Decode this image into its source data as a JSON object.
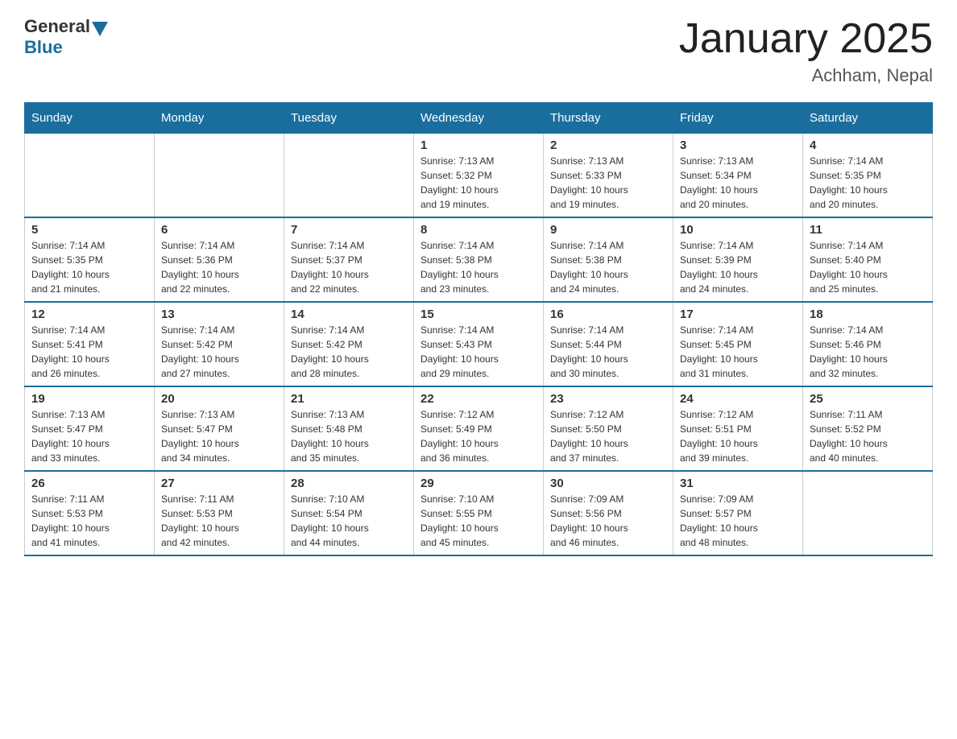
{
  "header": {
    "logo_general": "General",
    "logo_blue": "Blue",
    "title": "January 2025",
    "subtitle": "Achham, Nepal"
  },
  "calendar": {
    "days_of_week": [
      "Sunday",
      "Monday",
      "Tuesday",
      "Wednesday",
      "Thursday",
      "Friday",
      "Saturday"
    ],
    "weeks": [
      [
        {
          "day": "",
          "info": ""
        },
        {
          "day": "",
          "info": ""
        },
        {
          "day": "",
          "info": ""
        },
        {
          "day": "1",
          "info": "Sunrise: 7:13 AM\nSunset: 5:32 PM\nDaylight: 10 hours\nand 19 minutes."
        },
        {
          "day": "2",
          "info": "Sunrise: 7:13 AM\nSunset: 5:33 PM\nDaylight: 10 hours\nand 19 minutes."
        },
        {
          "day": "3",
          "info": "Sunrise: 7:13 AM\nSunset: 5:34 PM\nDaylight: 10 hours\nand 20 minutes."
        },
        {
          "day": "4",
          "info": "Sunrise: 7:14 AM\nSunset: 5:35 PM\nDaylight: 10 hours\nand 20 minutes."
        }
      ],
      [
        {
          "day": "5",
          "info": "Sunrise: 7:14 AM\nSunset: 5:35 PM\nDaylight: 10 hours\nand 21 minutes."
        },
        {
          "day": "6",
          "info": "Sunrise: 7:14 AM\nSunset: 5:36 PM\nDaylight: 10 hours\nand 22 minutes."
        },
        {
          "day": "7",
          "info": "Sunrise: 7:14 AM\nSunset: 5:37 PM\nDaylight: 10 hours\nand 22 minutes."
        },
        {
          "day": "8",
          "info": "Sunrise: 7:14 AM\nSunset: 5:38 PM\nDaylight: 10 hours\nand 23 minutes."
        },
        {
          "day": "9",
          "info": "Sunrise: 7:14 AM\nSunset: 5:38 PM\nDaylight: 10 hours\nand 24 minutes."
        },
        {
          "day": "10",
          "info": "Sunrise: 7:14 AM\nSunset: 5:39 PM\nDaylight: 10 hours\nand 24 minutes."
        },
        {
          "day": "11",
          "info": "Sunrise: 7:14 AM\nSunset: 5:40 PM\nDaylight: 10 hours\nand 25 minutes."
        }
      ],
      [
        {
          "day": "12",
          "info": "Sunrise: 7:14 AM\nSunset: 5:41 PM\nDaylight: 10 hours\nand 26 minutes."
        },
        {
          "day": "13",
          "info": "Sunrise: 7:14 AM\nSunset: 5:42 PM\nDaylight: 10 hours\nand 27 minutes."
        },
        {
          "day": "14",
          "info": "Sunrise: 7:14 AM\nSunset: 5:42 PM\nDaylight: 10 hours\nand 28 minutes."
        },
        {
          "day": "15",
          "info": "Sunrise: 7:14 AM\nSunset: 5:43 PM\nDaylight: 10 hours\nand 29 minutes."
        },
        {
          "day": "16",
          "info": "Sunrise: 7:14 AM\nSunset: 5:44 PM\nDaylight: 10 hours\nand 30 minutes."
        },
        {
          "day": "17",
          "info": "Sunrise: 7:14 AM\nSunset: 5:45 PM\nDaylight: 10 hours\nand 31 minutes."
        },
        {
          "day": "18",
          "info": "Sunrise: 7:14 AM\nSunset: 5:46 PM\nDaylight: 10 hours\nand 32 minutes."
        }
      ],
      [
        {
          "day": "19",
          "info": "Sunrise: 7:13 AM\nSunset: 5:47 PM\nDaylight: 10 hours\nand 33 minutes."
        },
        {
          "day": "20",
          "info": "Sunrise: 7:13 AM\nSunset: 5:47 PM\nDaylight: 10 hours\nand 34 minutes."
        },
        {
          "day": "21",
          "info": "Sunrise: 7:13 AM\nSunset: 5:48 PM\nDaylight: 10 hours\nand 35 minutes."
        },
        {
          "day": "22",
          "info": "Sunrise: 7:12 AM\nSunset: 5:49 PM\nDaylight: 10 hours\nand 36 minutes."
        },
        {
          "day": "23",
          "info": "Sunrise: 7:12 AM\nSunset: 5:50 PM\nDaylight: 10 hours\nand 37 minutes."
        },
        {
          "day": "24",
          "info": "Sunrise: 7:12 AM\nSunset: 5:51 PM\nDaylight: 10 hours\nand 39 minutes."
        },
        {
          "day": "25",
          "info": "Sunrise: 7:11 AM\nSunset: 5:52 PM\nDaylight: 10 hours\nand 40 minutes."
        }
      ],
      [
        {
          "day": "26",
          "info": "Sunrise: 7:11 AM\nSunset: 5:53 PM\nDaylight: 10 hours\nand 41 minutes."
        },
        {
          "day": "27",
          "info": "Sunrise: 7:11 AM\nSunset: 5:53 PM\nDaylight: 10 hours\nand 42 minutes."
        },
        {
          "day": "28",
          "info": "Sunrise: 7:10 AM\nSunset: 5:54 PM\nDaylight: 10 hours\nand 44 minutes."
        },
        {
          "day": "29",
          "info": "Sunrise: 7:10 AM\nSunset: 5:55 PM\nDaylight: 10 hours\nand 45 minutes."
        },
        {
          "day": "30",
          "info": "Sunrise: 7:09 AM\nSunset: 5:56 PM\nDaylight: 10 hours\nand 46 minutes."
        },
        {
          "day": "31",
          "info": "Sunrise: 7:09 AM\nSunset: 5:57 PM\nDaylight: 10 hours\nand 48 minutes."
        },
        {
          "day": "",
          "info": ""
        }
      ]
    ]
  }
}
